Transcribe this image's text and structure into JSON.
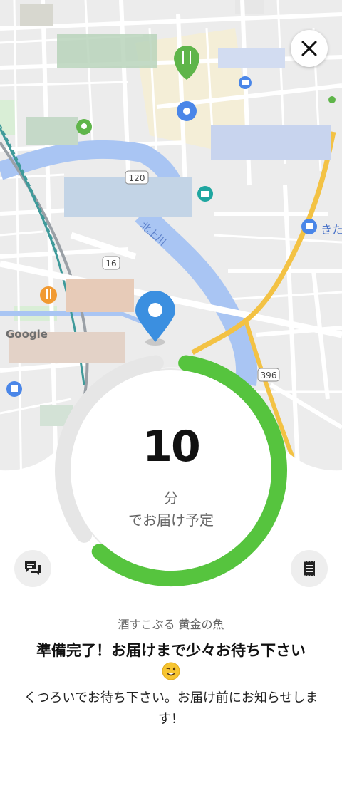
{
  "map": {
    "road_badges": [
      "120",
      "16",
      "396"
    ],
    "river_label": "北上川",
    "edge_label": "きた",
    "watermark": "Google"
  },
  "close_button": {
    "icon": "close-icon"
  },
  "eta": {
    "minutes": "10",
    "unit": "分",
    "label": "でお届け予定",
    "progress_fraction": 0.62,
    "color": "#56c43e"
  },
  "store_name": "酒すこぶる 黄金の魚",
  "headline": "準備完了！お届けまで少々お待ち下さい",
  "emoji": "winking-face",
  "message": "くつろいでお待ち下さい。お届け前にお知らせします！",
  "actions": {
    "chat_icon": "chat-icon",
    "receipt_icon": "receipt-icon"
  }
}
